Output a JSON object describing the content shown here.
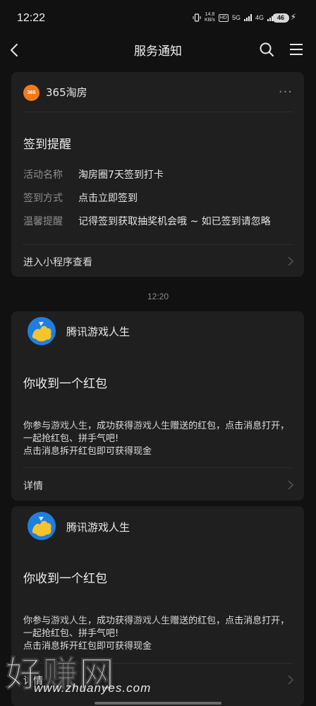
{
  "status_bar": {
    "time": "12:22",
    "speed_top": "14.8",
    "speed_unit": "KB/s",
    "hd_badge": "HD",
    "network1": "5G",
    "network2": "4G",
    "battery": "46"
  },
  "nav": {
    "title": "服务通知",
    "back_icon": "chevron-left-icon",
    "search_icon": "search-icon",
    "menu_icon": "menu-icon"
  },
  "card1": {
    "logo_text": "365",
    "source": "365淘房",
    "more": "···",
    "title": "签到提醒",
    "fields": [
      {
        "label": "活动名称",
        "value": "淘房圈7天签到打卡"
      },
      {
        "label": "签到方式",
        "value": "点击立即签到"
      },
      {
        "label": "温馨提醒",
        "value": "记得签到获取抽奖机会哦 ~ 如已签到请忽略"
      }
    ],
    "footer": "进入小程序查看"
  },
  "timestamp": "12:20",
  "card2": {
    "source": "腾讯游戏人生",
    "title": "你收到一个红包",
    "body_line1_a": "你参与",
    "body_line1_hl1": "游戏人生",
    "body_line1_b": "，成功获得",
    "body_line1_hl2": "游戏人生",
    "body_line1_c": "赠送的红包，点击消息打开，一起抢红包、拼手气吧!",
    "body_line2": "点击消息拆开红包即可获得现金",
    "footer": "详情"
  },
  "card3": {
    "source": "腾讯游戏人生",
    "title": "你收到一个红包",
    "body_line1_a": "你参与",
    "body_line1_hl1": "游戏人生",
    "body_line1_b": "，成功获得",
    "body_line1_hl2": "游戏人生",
    "body_line1_c": "赠送的红包，点击消息打开，一起抢红包、拼手气吧!",
    "body_line2": "点击消息拆开红包即可获得现金",
    "footer": "详情"
  },
  "watermark": {
    "text": "好赚网",
    "url": "www.zhuanyes.com"
  },
  "colors": {
    "background": "#111111",
    "card": "#1f1f1f",
    "logo_orange": "#f07a1a",
    "game_blue": "#1f7fe0",
    "game_yellow": "#f5c32c"
  }
}
